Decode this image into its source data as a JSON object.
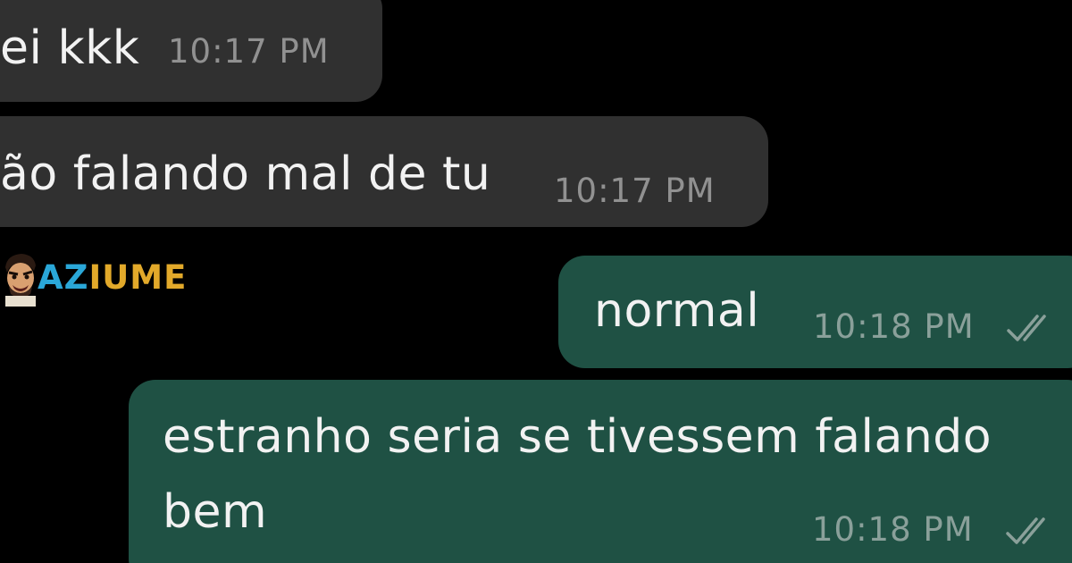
{
  "messages": [
    {
      "direction": "incoming",
      "text": "ei kkk",
      "time": "10:17 PM"
    },
    {
      "direction": "incoming",
      "text": "ão falando mal de tu",
      "time": "10:17 PM"
    },
    {
      "direction": "outgoing",
      "text": "normal",
      "time": "10:18 PM",
      "status_icon": "double-check-icon"
    },
    {
      "direction": "outgoing",
      "text": "estranho seria se tivessem falando bem",
      "time": "10:18 PM",
      "status_icon": "double-check-icon"
    }
  ],
  "watermark": {
    "brand": "AZIUME",
    "brand_first": "AZ",
    "brand_rest": "IUME"
  },
  "colors": {
    "background": "#000000",
    "incoming_bubble": "#303030",
    "outgoing_bubble": "#1f5144",
    "text": "#f2f2f2",
    "logo_blue": "#2aa7d8",
    "logo_gold": "#e2a92a"
  }
}
